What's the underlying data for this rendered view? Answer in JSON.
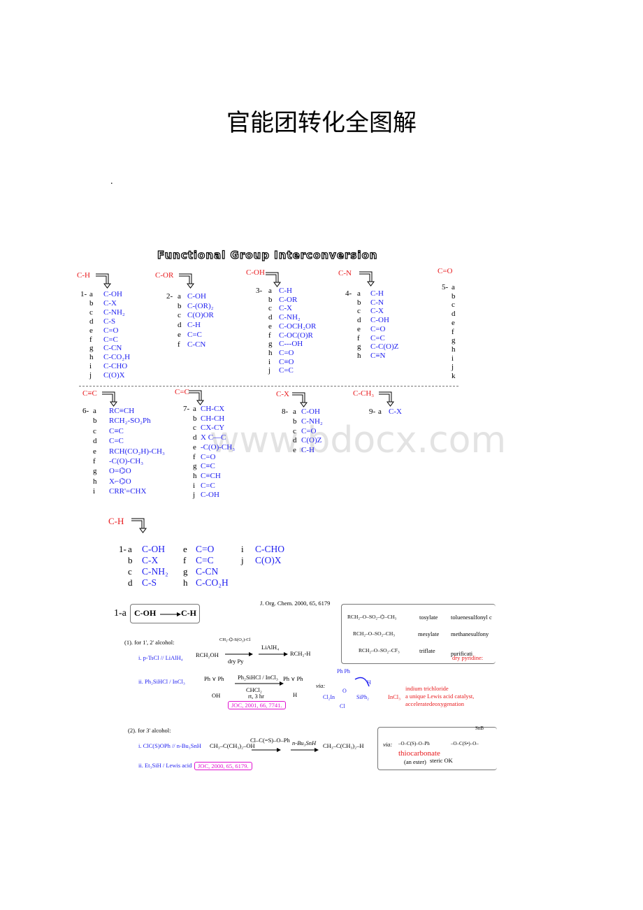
{
  "doc_title": "官能团转化全图解",
  "dot": ".",
  "watermark": "www.bdocx.com",
  "figure_title": "Functional Group Interconversion",
  "groups": [
    {
      "header": "C-H",
      "num": "1-",
      "items": [
        [
          "a",
          "C-OH"
        ],
        [
          "b",
          "C-X"
        ],
        [
          "c",
          "C-NH₂"
        ],
        [
          "d",
          "C-S"
        ],
        [
          "e",
          "C=O"
        ],
        [
          "f",
          "C=C"
        ],
        [
          "g",
          "C-CN"
        ],
        [
          "h",
          "C-CO₂H"
        ],
        [
          "i",
          "C-CHO"
        ],
        [
          "j",
          "C(O)X"
        ]
      ]
    },
    {
      "header": "C-OR",
      "num": "2-",
      "items": [
        [
          "a",
          "C-OH"
        ],
        [
          "b",
          "C-(OR)₂"
        ],
        [
          "c",
          "C(O)OR"
        ],
        [
          "d",
          "C-H"
        ],
        [
          "e",
          "C=C"
        ],
        [
          "f",
          "C-CN"
        ]
      ]
    },
    {
      "header": "C-OH",
      "num": "3-",
      "items": [
        [
          "a",
          "C-H"
        ],
        [
          "b",
          "C-OR"
        ],
        [
          "c",
          "C-X"
        ],
        [
          "d",
          "C-NH₂"
        ],
        [
          "e",
          "C-OCH₂OR"
        ],
        [
          "f",
          "C-OC(O)R"
        ],
        [
          "g",
          "C---OH"
        ],
        [
          "h",
          "C=O"
        ],
        [
          "i",
          "C≡O"
        ],
        [
          "j",
          "C=C"
        ]
      ]
    },
    {
      "header": "C-N",
      "num": "4-",
      "items": [
        [
          "a",
          "C-H"
        ],
        [
          "b",
          "C-N"
        ],
        [
          "c",
          "C-X"
        ],
        [
          "d",
          "C-OH"
        ],
        [
          "e",
          "C=O"
        ],
        [
          "f",
          "C=C"
        ],
        [
          "g",
          "C-C(O)Z"
        ],
        [
          "h",
          "C≡N"
        ]
      ]
    },
    {
      "header": "C=O",
      "num": "5-",
      "items": [
        [
          "a",
          ""
        ],
        [
          "b",
          ""
        ],
        [
          "c",
          ""
        ],
        [
          "d",
          ""
        ],
        [
          "e",
          ""
        ],
        [
          "f",
          ""
        ],
        [
          "g",
          ""
        ],
        [
          "h",
          ""
        ],
        [
          "i",
          ""
        ],
        [
          "j",
          ""
        ],
        [
          "k",
          ""
        ]
      ]
    },
    {
      "header": "C≡C",
      "num": "6-",
      "items": [
        [
          "a",
          "RC≡CH"
        ],
        [
          "b",
          "RCH₂-SO₂Ph"
        ],
        [
          "c",
          "C≡C"
        ],
        [
          "d",
          "C=C"
        ],
        [
          "e",
          "RCH(CO₂H)-CH₃"
        ],
        [
          "f",
          "-C(O)-CH₃"
        ],
        [
          "g",
          "O=⌬O"
        ],
        [
          "h",
          "X⌐⌬O"
        ],
        [
          "i",
          "CRR'=CHX"
        ]
      ]
    },
    {
      "header": "C=C",
      "num": "7-",
      "items": [
        [
          "a",
          "CH-CX"
        ],
        [
          "b",
          "CH-CH"
        ],
        [
          "c",
          "CX-CY"
        ],
        [
          "d",
          "X C—C"
        ],
        [
          "e",
          "-C(O)-CH₃"
        ],
        [
          "f",
          "C=O"
        ],
        [
          "g",
          "C≡C"
        ],
        [
          "h",
          "C≡CH"
        ],
        [
          "i",
          "C=C"
        ],
        [
          "j",
          "C-OH"
        ]
      ]
    },
    {
      "header": "C-X",
      "num": "8-",
      "items": [
        [
          "a",
          "C-OH"
        ],
        [
          "b",
          "C-NH₂"
        ],
        [
          "c",
          "C=O"
        ],
        [
          "d",
          "C(O)Z"
        ],
        [
          "e",
          "C-H"
        ]
      ]
    },
    {
      "header": "C-CH₃",
      "num": "9-",
      "items": [
        [
          "a",
          "C-X"
        ]
      ]
    }
  ],
  "ch_section": {
    "header": "C-H",
    "num": "1-",
    "items": [
      [
        "a",
        "C-OH"
      ],
      [
        "b",
        "C-X"
      ],
      [
        "c",
        "C-NH₂"
      ],
      [
        "d",
        "C-S"
      ],
      [
        "e",
        "C=O"
      ],
      [
        "f",
        "C=C"
      ],
      [
        "g",
        "C-CN"
      ],
      [
        "h",
        "C-CO₂H"
      ],
      [
        "i",
        "C-CHO"
      ],
      [
        "j",
        "C(O)X"
      ]
    ]
  },
  "scheme": {
    "label": "1-a",
    "from": "C-OH",
    "to": "C-H",
    "journal_ref": "J. Org. Chem. 2000, 65, 6179",
    "part1": "(1). for 1', 2' alcohol:",
    "method_i": "i. p-TsCl // LiAlH₄",
    "rch2oh": "RCH₂OH",
    "tscl": "CH₃-⌬-S(O₂)-Cl",
    "dry_py": "dry Py",
    "lialh4": "LiAlH₄",
    "rch2h": "RCH₂-H",
    "method_ii": "ii. Ph₂SiHCl / InCl₃",
    "ph_ph_oh": "Ph ⋎ Ph",
    "oh": "OH",
    "reagent2": "Ph₂SiHCl / InCl₃",
    "solvent": "CHCl₂",
    "cond": "rt, 3 hr",
    "ph_ph_h": "Ph ⋎ Ph",
    "h": "H",
    "ref2": "JOC, 2001, 66, 7741.",
    "via": "via:",
    "mech_ph": "Ph   Ph",
    "mech_h": "H",
    "mech_o": "O",
    "mech_cl2in": "Cl₂In",
    "mech_siph2": "SiPh₂",
    "mech_cl": "Cl",
    "incl3": "InCl₃",
    "incl3_notes": [
      "indium trichloride",
      "a unique Lewis acid catalyst,",
      "acceleratedeoxygenation"
    ],
    "sulfonates": [
      {
        "formula": "RCH₂–O–SO₂–⌬–CH₃",
        "name": "tosylate",
        "full": "toluenesulfonyl c"
      },
      {
        "formula": "RCH₂–O–SO₂–CH₃",
        "name": "mesylate",
        "full": "methanesulfony"
      },
      {
        "formula": "RCH₂–O–SO₂–CF₃",
        "name": "triflate",
        "full": "purificati"
      }
    ],
    "dry_pyridine": "dry pyridine:",
    "part2": "(2). for 3' alcohol:",
    "method2_i": "i. ClC(S)OPh // n-Bu₃SnH",
    "method2_ii": "ii. Et₃SiH / Lewis acid",
    "ref3": "JOC, 2000, 65, 6179.",
    "tbuoh": "CH₃–C(CH₃)₂–OH",
    "clcsoph": "Cl–C(=S)–O–Ph",
    "bu3snh": "n-Bu₃SnH",
    "tbuh": "CH₃–C(CH₃)₂–H",
    "via2": "via:",
    "thio1": "–O–C(S)–O–Ph",
    "thio2": "–O–C(S•)–O–",
    "snbu": "SnB",
    "thiocarbonate": "thiocarbonate",
    "an_ester": "(an ester)",
    "steric": "steric OK"
  },
  "colors": {
    "header_red": "#e8191c",
    "item_blue": "#2020f0",
    "ref_magenta": "#e010d0"
  }
}
